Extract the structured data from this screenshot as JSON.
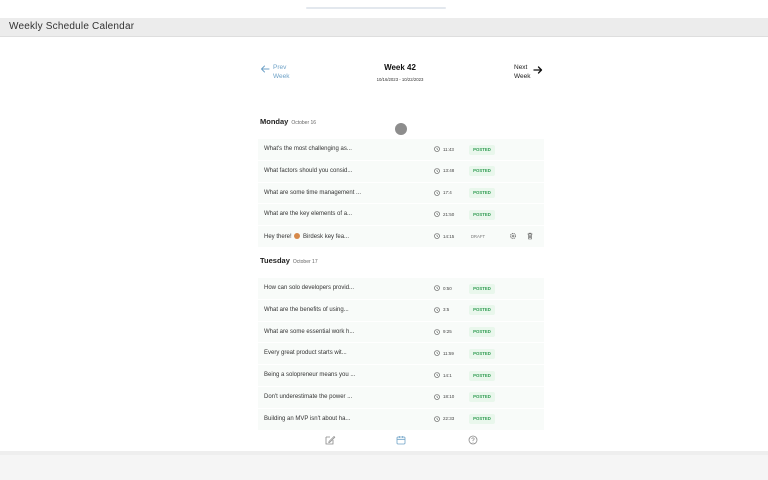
{
  "window": {
    "title": "Weekly Schedule Calendar"
  },
  "nav": {
    "prev_label_1": "Prev",
    "prev_label_2": "Week",
    "next_label_1": "Next",
    "next_label_2": "Week",
    "week_title": "Week 42",
    "week_range": "10/16/2023 - 10/22/2023"
  },
  "days": [
    {
      "name": "Monday",
      "date": "October 16",
      "items": [
        {
          "title": "What's the most challenging as...",
          "time": "11:43",
          "status": "POSTED"
        },
        {
          "title": "What factors should you consid...",
          "time": "13:48",
          "status": "POSTED"
        },
        {
          "title": "What are some time management ...",
          "time": "17:4",
          "status": "POSTED"
        },
        {
          "title": "What are the key elements of a...",
          "time": "21:50",
          "status": "POSTED"
        },
        {
          "title_pre": "Hey there!",
          "title_post": "Birdesk key fea...",
          "time": "14:15",
          "status": "DRAFT"
        }
      ]
    },
    {
      "name": "Tuesday",
      "date": "October 17",
      "items": [
        {
          "title": "How can solo developers provid...",
          "time": "0:50",
          "status": "POSTED"
        },
        {
          "title": "What are the benefits of using...",
          "time": "3:5",
          "status": "POSTED"
        },
        {
          "title": "What are some essential work h...",
          "time": "9:25",
          "status": "POSTED"
        },
        {
          "title": "Every great product starts wit...",
          "time": "11:59",
          "status": "POSTED"
        },
        {
          "title": "Being a solopreneur means you ...",
          "time": "14:1",
          "status": "POSTED"
        },
        {
          "title": "Don't underestimate the power ...",
          "time": "18:10",
          "status": "POSTED"
        },
        {
          "title": "Building an MVP isn't about ha...",
          "time": "22:33",
          "status": "POSTED"
        }
      ]
    }
  ],
  "icons": {
    "prev": "arrow-left-icon",
    "next": "arrow-right-icon",
    "clock": "clock-icon",
    "settings": "gear-icon",
    "delete": "trash-icon",
    "compose": "compose-icon",
    "calendar": "calendar-icon",
    "help": "help-icon"
  },
  "colors": {
    "accent": "#6fa2c7",
    "posted_bg": "#e9f7ec",
    "posted_text": "#2e9b50"
  }
}
